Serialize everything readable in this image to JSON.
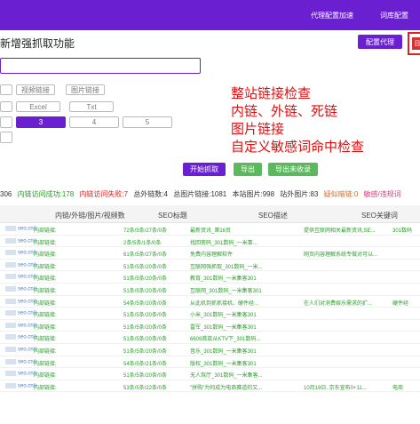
{
  "nav": {
    "proxy_config": "代理配置加速",
    "library": "词库配置"
  },
  "page_title": "新增强抓取功能",
  "toolbar": {
    "proxy_button": "配置代理",
    "red_box_label": "目"
  },
  "url_input": {
    "value": "",
    "placeholder": ""
  },
  "type_filters": [
    "",
    "视频链接",
    "图片链接"
  ],
  "format_options": [
    "",
    "Excel",
    "Txt"
  ],
  "depth_options": [
    "",
    "3",
    "4",
    "5"
  ],
  "selected_depth": "3",
  "actions": {
    "start": "开始抓取",
    "export": "导出",
    "export_unindexed": "导出未收录"
  },
  "annotation_lines": [
    "整站链接检查",
    "内链、外链、死链",
    "图片链接",
    "自定义敏感词命中检查"
  ],
  "stats": [
    {
      "text": "306",
      "tone": "normal"
    },
    {
      "text": "内链访问成功:178",
      "tone": "green"
    },
    {
      "text": "内链访问失败:7",
      "tone": "red"
    },
    {
      "text": "总外链数:4",
      "tone": "normal"
    },
    {
      "text": "总图片链接:1081",
      "tone": "normal"
    },
    {
      "text": "本站图片:998",
      "tone": "normal"
    },
    {
      "text": "站外图片:83",
      "tone": "normal"
    },
    {
      "text": "疑似暗链:0",
      "tone": "orange"
    },
    {
      "text": "敏感/违规词",
      "tone": "pink"
    }
  ],
  "table": {
    "headers": [
      "内链/外链/图片/视频数",
      "SEO标题",
      "SEO描述",
      "SEO关键词"
    ],
    "rows": [
      {
        "url": "seo.cn/i",
        "type": "内部链接:",
        "counts": "72条/5条/27条/0条",
        "title": "最新资讯_第16页",
        "desc": "提供互联网相关最新资讯,SE...",
        "kw": "301数码"
      },
      {
        "url": "seo.cn/i",
        "type": "内部链接:",
        "counts": "2条/5条/1条/0条",
        "title": "找回密码_301数码_一米事...",
        "desc": "",
        "kw": ""
      },
      {
        "url": "seo.cn/i",
        "type": "内部链接:",
        "counts": "61条/5条/27条/0条",
        "title": "免费内容理解软件",
        "desc": "网页内容理解系统专做对可以...",
        "kw": ""
      },
      {
        "url": "seo.cn/i",
        "type": "内部链接:",
        "counts": "51条/5条/20条/0条",
        "title": "互联网强抓取_301数码_一米...",
        "desc": "",
        "kw": ""
      },
      {
        "url": "seo.cn/i",
        "type": "内部链接:",
        "counts": "51条/5条/20条/0条",
        "title": "教育_301数码_一米集客301",
        "desc": "",
        "kw": ""
      },
      {
        "url": "seo.cn/i",
        "type": "内部链接:",
        "counts": "51条/5条/20条/0条",
        "title": "互联网_301数码_一米集客301",
        "desc": "",
        "kw": ""
      },
      {
        "url": "seo.cn/i",
        "type": "内部链接:",
        "counts": "54条/5条/20条/0条",
        "title": "从此机到抓抓接机、硬件经...",
        "desc": "在人们对消费娱乐需求的扩...",
        "kw": "硬件经"
      },
      {
        "url": "seo.cn/i",
        "type": "内部链接:",
        "counts": "51条/5条/20条/0条",
        "title": "小米_301数码_一米集客301",
        "desc": "",
        "kw": ""
      },
      {
        "url": "seo.cn/i",
        "type": "内部链接:",
        "counts": "51条/5条/20条/0条",
        "title": "雷军_301数码_一米集客301",
        "desc": "",
        "kw": ""
      },
      {
        "url": "seo.cn/i",
        "type": "内部链接:",
        "counts": "51条/5条/20条/0条",
        "title": "6609首款从KTV下_301数码...",
        "desc": "",
        "kw": ""
      },
      {
        "url": "seo.cn/i",
        "type": "内部链接:",
        "counts": "51条/5条/20条/0条",
        "title": "音乐_301数码_一米集客301",
        "desc": "",
        "kw": ""
      },
      {
        "url": "seo.cn/i",
        "type": "内部链接:",
        "counts": "54条/5条/21条/0条",
        "title": "版权_301数码_一米集客301",
        "desc": "",
        "kw": ""
      },
      {
        "url": "seo.cn/i",
        "type": "内部链接:",
        "counts": "51条/5条/20条/0条",
        "title": "无人驾厅_301数码_一米集客...",
        "desc": "",
        "kw": ""
      },
      {
        "url": "seo.cn/i",
        "type": "内部链接:",
        "counts": "53条/5条/22条/0条",
        "title": "\"拼购\"为何成为电商赛道的又...",
        "desc": "10月19日, 京东宣布0+11...",
        "kw": "电商"
      }
    ]
  }
}
